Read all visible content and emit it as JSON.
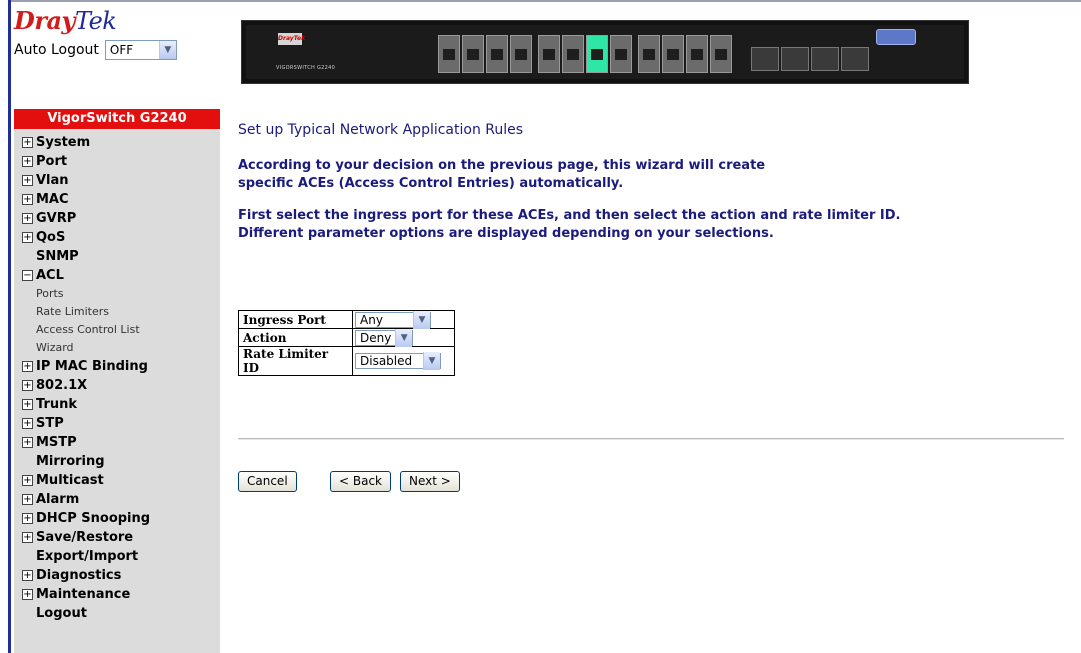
{
  "header": {
    "logo_dray": "Dray",
    "logo_tek": "Tek",
    "auto_logout_label": "Auto Logout",
    "auto_logout_value": "OFF",
    "panel_logo": "DrayTek",
    "panel_model": "VIGORSWITCH G2240"
  },
  "sidebar": {
    "title": "VigorSwitch G2240",
    "items": [
      {
        "label": "System",
        "expander": "+"
      },
      {
        "label": "Port",
        "expander": "+"
      },
      {
        "label": "Vlan",
        "expander": "+"
      },
      {
        "label": "MAC",
        "expander": "+"
      },
      {
        "label": "GVRP",
        "expander": "+"
      },
      {
        "label": "QoS",
        "expander": "+"
      },
      {
        "label": "SNMP",
        "expander": ""
      },
      {
        "label": "ACL",
        "expander": "−"
      },
      {
        "label": "Ports",
        "sub": true
      },
      {
        "label": "Rate Limiters",
        "sub": true
      },
      {
        "label": "Access Control List",
        "sub": true
      },
      {
        "label": "Wizard",
        "sub": true
      },
      {
        "label": "IP MAC Binding",
        "expander": "+"
      },
      {
        "label": "802.1X",
        "expander": "+"
      },
      {
        "label": "Trunk",
        "expander": "+"
      },
      {
        "label": "STP",
        "expander": "+"
      },
      {
        "label": "MSTP",
        "expander": "+"
      },
      {
        "label": "Mirroring",
        "expander": ""
      },
      {
        "label": "Multicast",
        "expander": "+"
      },
      {
        "label": "Alarm",
        "expander": "+"
      },
      {
        "label": "DHCP Snooping",
        "expander": "+"
      },
      {
        "label": "Save/Restore",
        "expander": "+"
      },
      {
        "label": "Export/Import",
        "expander": ""
      },
      {
        "label": "Diagnostics",
        "expander": "+"
      },
      {
        "label": "Maintenance",
        "expander": "+"
      },
      {
        "label": "Logout",
        "expander": ""
      }
    ]
  },
  "main": {
    "title": "Set up Typical Network Application Rules",
    "para1_line1": "According to your decision on the previous page, this wizard will create",
    "para1_line2": "specific ACEs (Access Control Entries) automatically.",
    "para2_line1": "First select the ingress port for these ACEs, and then select the action and rate limiter ID.",
    "para2_line2": "Different parameter options are displayed depending on your selections.",
    "form": {
      "ingress_port_label": "Ingress Port",
      "ingress_port_value": "Any",
      "action_label": "Action",
      "action_value": "Deny",
      "rate_limiter_label": "Rate Limiter ID",
      "rate_limiter_value": "Disabled"
    },
    "buttons": {
      "cancel": "Cancel",
      "back": "< Back",
      "next": "Next >"
    }
  },
  "colors": {
    "brand_red": "#e30f0f",
    "heading_blue": "#1b1b7d",
    "sidebar_bg": "#dcdcdc"
  }
}
